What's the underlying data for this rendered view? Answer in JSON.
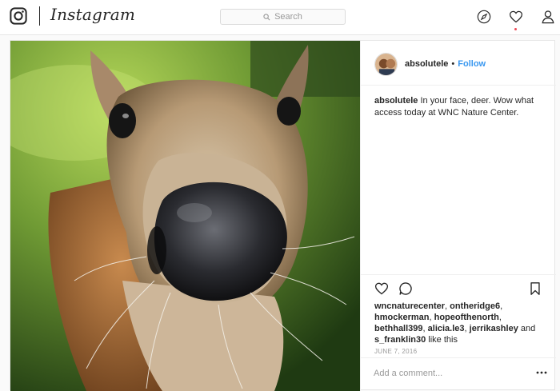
{
  "header": {
    "brand": "Instagram",
    "search_placeholder": "Search",
    "icons": [
      "instagram-logo-icon",
      "compass-icon",
      "heart-icon",
      "profile-icon"
    ]
  },
  "post": {
    "owner": "absolutele",
    "separator": "•",
    "follow_label": "Follow",
    "caption": {
      "user": "absolutele",
      "text": "In your face, deer. Wow what access today at WNC Nature Center."
    },
    "likes": {
      "users": [
        "wncnaturecenter",
        "ontheridge6",
        "hmockerman",
        "hopeofthenorth",
        "bethhall399",
        "alicia.le3",
        "jerrikashley",
        "s_franklin30"
      ],
      "and": "and",
      "suffix": "like this"
    },
    "timestamp": "JUNE 7, 2016",
    "comment_placeholder": "Add a comment...",
    "action_icons": [
      "heart-icon",
      "comment-icon",
      "bookmark-icon",
      "more-options-icon"
    ]
  },
  "colors": {
    "link": "#3897f0",
    "notification": "#ed4956",
    "text": "#262626",
    "muted": "#999999",
    "border": "#e6e6e6"
  }
}
